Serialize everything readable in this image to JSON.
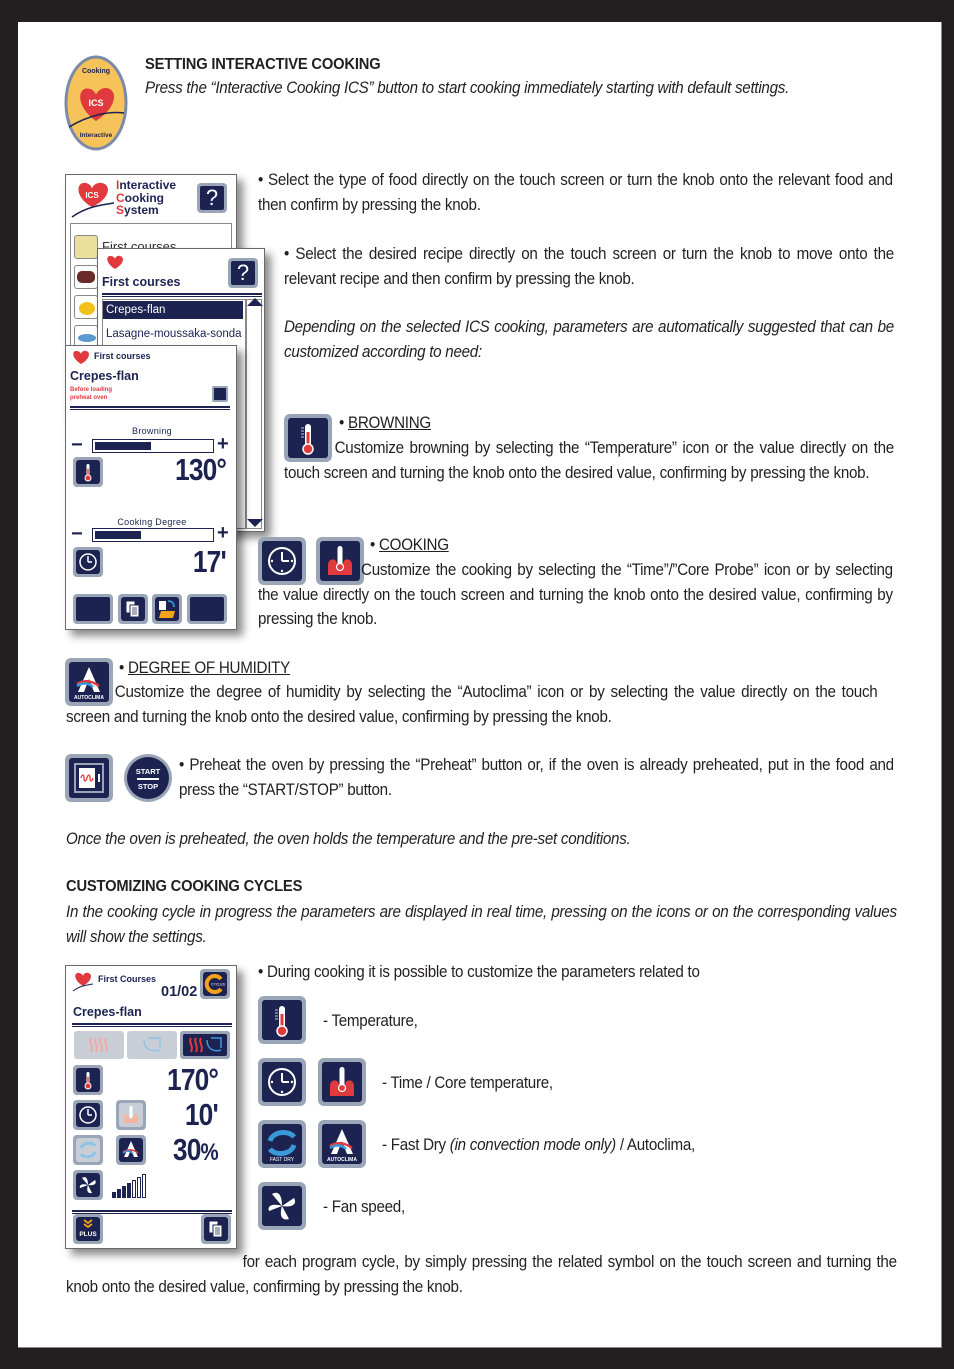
{
  "section1": {
    "logo": {
      "top_text": "Cooking",
      "center_text": "ICS",
      "bottom_text": "Interactive"
    },
    "title": "SETTING INTERACTIVE COOKING",
    "subtitle": "Press the “Interactive Cooking ICS” button to start cooking immediately starting with default settings."
  },
  "screen1": {
    "ics_badge": "ICS",
    "title_lines": [
      {
        "initial": "I",
        "rest": "nteractive"
      },
      {
        "initial": "C",
        "rest": "ooking"
      },
      {
        "initial": "S",
        "rest": "ystem"
      }
    ],
    "help_label": "?",
    "list_first_item": "First courses"
  },
  "screen2": {
    "title": "First courses",
    "help_label": "?",
    "recipes": [
      "Crepes-flan",
      "Lasagne-moussaka-sonda"
    ],
    "selected_index": 0
  },
  "screen3": {
    "category": "First courses",
    "recipe": "Crepes-flan",
    "warning_line1": "Before loading",
    "warning_line2": "preheat oven",
    "browning_label": "Browning",
    "browning_level": 0.5,
    "temperature": "130°",
    "cooking_degree_label": "Cooking Degree",
    "cooking_degree_level": 0.42,
    "time": "17'",
    "minus": "−",
    "plus": "+"
  },
  "paragraphs": {
    "select_food": "• Select the type of food directly on the touch screen or turn the knob onto the relevant food and then confirm by pressing the knob.",
    "select_recipe": "• Select the desired recipe directly on the touch screen or turn the knob to move onto the relevant recipe and then confirm by pressing the knob.",
    "depending": "Depending on the selected ICS cooking, parameters are automatically suggested that can be customized according to need:",
    "browning_heading": "BROWNING",
    "browning_text": "Customize browning by selecting the “Temperature” icon or the value directly on the touch screen and turning the knob onto the desired value, confirming by pressing the knob.",
    "cooking_heading": "COOKING",
    "cooking_text": "Customize the cooking by selecting the “Time”/”Core Probe” icon or by selecting the value directly on the touch screen and turning the knob onto the desired value, confirming by pressing the knob.",
    "humidity_heading": "DEGREE OF HUMIDITY",
    "humidity_text": "Customize the degree of humidity by selecting the “Autoclima” icon or by selecting the value directly on the touch screen and turning the knob onto the desired value, confirming by pressing the knob.",
    "preheat_text": "• Preheat the oven by pressing the “Preheat” button or, if the oven is already preheated, put in the food and press the “START/STOP” button.",
    "once_preheated": "Once the oven is preheated, the oven holds the temperature and the pre-set conditions.",
    "bullet": "• "
  },
  "icons": {
    "autoclima_label": "AUTOCLIMA",
    "fastdry_label": "FAST DRY",
    "start_label": "START",
    "stop_label": "STOP",
    "cycles_label": "CYCLES",
    "plus_label": "PLUS"
  },
  "section2": {
    "title": "CUSTOMIZING COOKING CYCLES",
    "subtitle": "In the cooking cycle in progress the parameters are displayed in real time, pressing on the icons or on the corresponding values will show the settings.",
    "intro": "• During cooking it is possible to customize the parameters related to",
    "params": [
      {
        "text": "- Temperature,"
      },
      {
        "text": "- Time / Core temperature,"
      },
      {
        "text_before": "- Fast Dry ",
        "text_italic": "(in convection mode only)",
        "text_after": " / Autoclima,"
      },
      {
        "text": "- Fan speed,"
      }
    ],
    "closing": "for each program cycle, by simply pressing the related symbol on the touch screen and turning the knob onto the desired value, confirming by pressing the knob."
  },
  "screen4": {
    "category": "First Courses",
    "cycle_counter": "01/02",
    "recipe": "Crepes-flan",
    "temperature": "170°",
    "time": "10'",
    "humidity_value": "30",
    "humidity_unit": "%",
    "fan_speed_level": 4,
    "fan_speed_max": 7
  },
  "colors": {
    "navy": "#1c2350",
    "tile_border": "#9aa6b8",
    "red": "#e03a3e",
    "logo_fill": "#f6c25a",
    "frame": "#231f20"
  }
}
